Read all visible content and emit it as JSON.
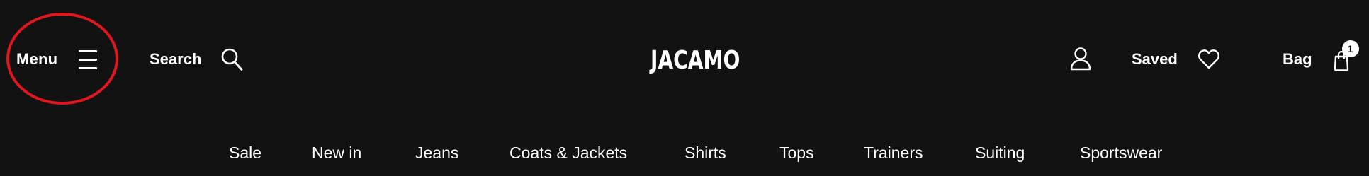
{
  "header": {
    "menu_label": "Menu",
    "search_label": "Search",
    "logo_text": "JACAMO",
    "saved_label": "Saved",
    "bag_label": "Bag",
    "bag_count": "1"
  },
  "nav": {
    "items": [
      {
        "label": "Sale"
      },
      {
        "label": "New in"
      },
      {
        "label": "Jeans"
      },
      {
        "label": "Coats & Jackets"
      },
      {
        "label": "Shirts"
      },
      {
        "label": "Tops"
      },
      {
        "label": "Trainers"
      },
      {
        "label": "Suiting"
      },
      {
        "label": "Sportswear"
      }
    ]
  },
  "icons": {
    "menu": "hamburger-icon",
    "search": "search-icon",
    "account": "user-icon",
    "saved": "heart-icon",
    "bag": "shopping-bag-icon"
  },
  "colors": {
    "background": "#121212",
    "text": "#ffffff",
    "annotation": "#e0171f"
  }
}
